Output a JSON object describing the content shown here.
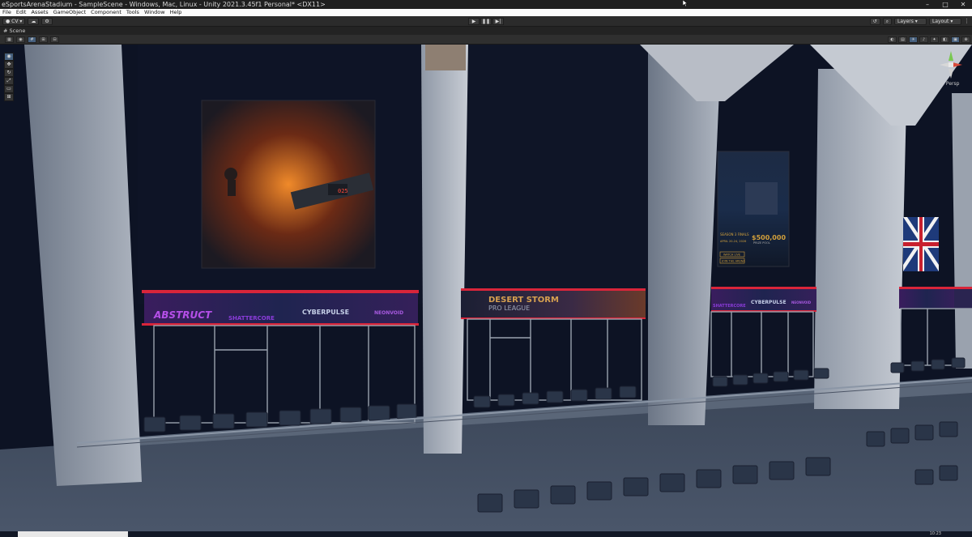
{
  "window": {
    "title": "eSportsArenaStadium - SampleScene - Windows, Mac, Linux - Unity 2021.3.45f1 Personal* <DX11>",
    "minimize": "–",
    "maximize": "□",
    "close": "✕"
  },
  "menu": [
    "File",
    "Edit",
    "Assets",
    "GameObject",
    "Component",
    "Tools",
    "Window",
    "Help"
  ],
  "toolbar": {
    "account": "CV",
    "play": "▶",
    "pause": "❚❚",
    "step": "▶|",
    "layers": "Layers",
    "layout": "Layout"
  },
  "scene_tab": "Scene",
  "scene_view": {
    "persp_label": "< Persp",
    "left_poster_counter": "025",
    "right_poster": {
      "headline": "SEASON 3 FINALS",
      "prize": "$500,000",
      "prize_label": "PRIZE POOL",
      "date": "APRIL 20-24, 2026",
      "button1": "WATCH LIVE",
      "button2": "JOIN THE ARENA"
    },
    "banners": {
      "left": [
        "ABSTRUCT",
        "SHATTERCORE",
        "CYBERPULSE",
        "NEONVOID"
      ],
      "middle_line1": "DESERT STORM",
      "middle_line2": "PRO LEAGUE",
      "right": [
        "SHATTERCORE",
        "CYBERPULSE",
        "NEONVOID"
      ]
    }
  },
  "taskbar": {
    "clock": "10:23"
  },
  "colors": {
    "accent": "#46607e",
    "banner_red": "#d9253a",
    "banner_purple": "#8a3cd9",
    "gold": "#d2a03c"
  }
}
